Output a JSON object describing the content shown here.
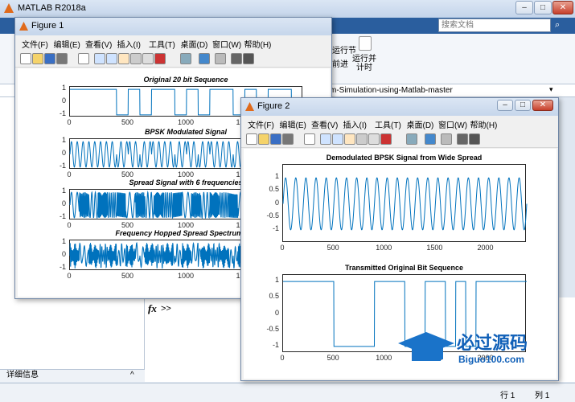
{
  "main": {
    "title": "MATLAB R2018a",
    "search_placeholder": "搜索文档",
    "ribbon_item1": "运行节",
    "ribbon_item2": "前进",
    "ribbon_run_time": "运行并\n计时",
    "path": "m-Simulation-using-Matlab-master",
    "details_label": "详细信息",
    "cmd_prompt": ">>",
    "status_row": "行 1",
    "status_col": "列 1"
  },
  "figure1": {
    "title": "Figure 1",
    "menus": [
      "文件(F)",
      "编辑(E)",
      "查看(V)",
      "插入(I)",
      "工具(T)",
      "桌面(D)",
      "窗口(W)",
      "帮助(H)"
    ],
    "plots": [
      {
        "title": "Original 20 bit Sequence",
        "yticks": [
          "1",
          "0",
          "-1"
        ],
        "xticks": [
          "0",
          "500",
          "1000",
          "1500"
        ]
      },
      {
        "title": "BPSK Modulated Signal",
        "yticks": [
          "1",
          "0",
          "-1"
        ],
        "xticks": [
          "0",
          "500",
          "1000",
          "1500"
        ]
      },
      {
        "title": "Spread Signal with 6 frequencies",
        "yticks": [
          "1",
          "0",
          "-1"
        ],
        "xticks": [
          "0",
          "500",
          "1000",
          "1500"
        ]
      },
      {
        "title": "Frequency Hopped Spread Spectrum Sig",
        "yticks": [
          "1",
          "0",
          "-1"
        ],
        "xticks": [
          "0",
          "500",
          "1000",
          "1500"
        ]
      }
    ]
  },
  "figure2": {
    "title": "Figure 2",
    "menus": [
      "文件(F)",
      "编辑(E)",
      "查看(V)",
      "插入(I)",
      "工具(T)",
      "桌面(D)",
      "窗口(W)",
      "帮助(H)"
    ],
    "plots": [
      {
        "title": "Demodulated BPSK Signal from Wide Spread",
        "yticks": [
          "1",
          "0.5",
          "0",
          "-0.5",
          "-1"
        ],
        "xticks": [
          "0",
          "500",
          "1000",
          "1500",
          "2000"
        ]
      },
      {
        "title": "Transmitted Original Bit Sequence",
        "yticks": [
          "1",
          "0.5",
          "0",
          "-0.5",
          "-1"
        ],
        "xticks": [
          "0",
          "500",
          "1000",
          "1500",
          "2000"
        ]
      }
    ]
  },
  "watermark": {
    "brand": "必过源码",
    "url": "Biguo100.com"
  },
  "colors": {
    "line": "#0072bd",
    "accent": "#2a5e9e"
  }
}
